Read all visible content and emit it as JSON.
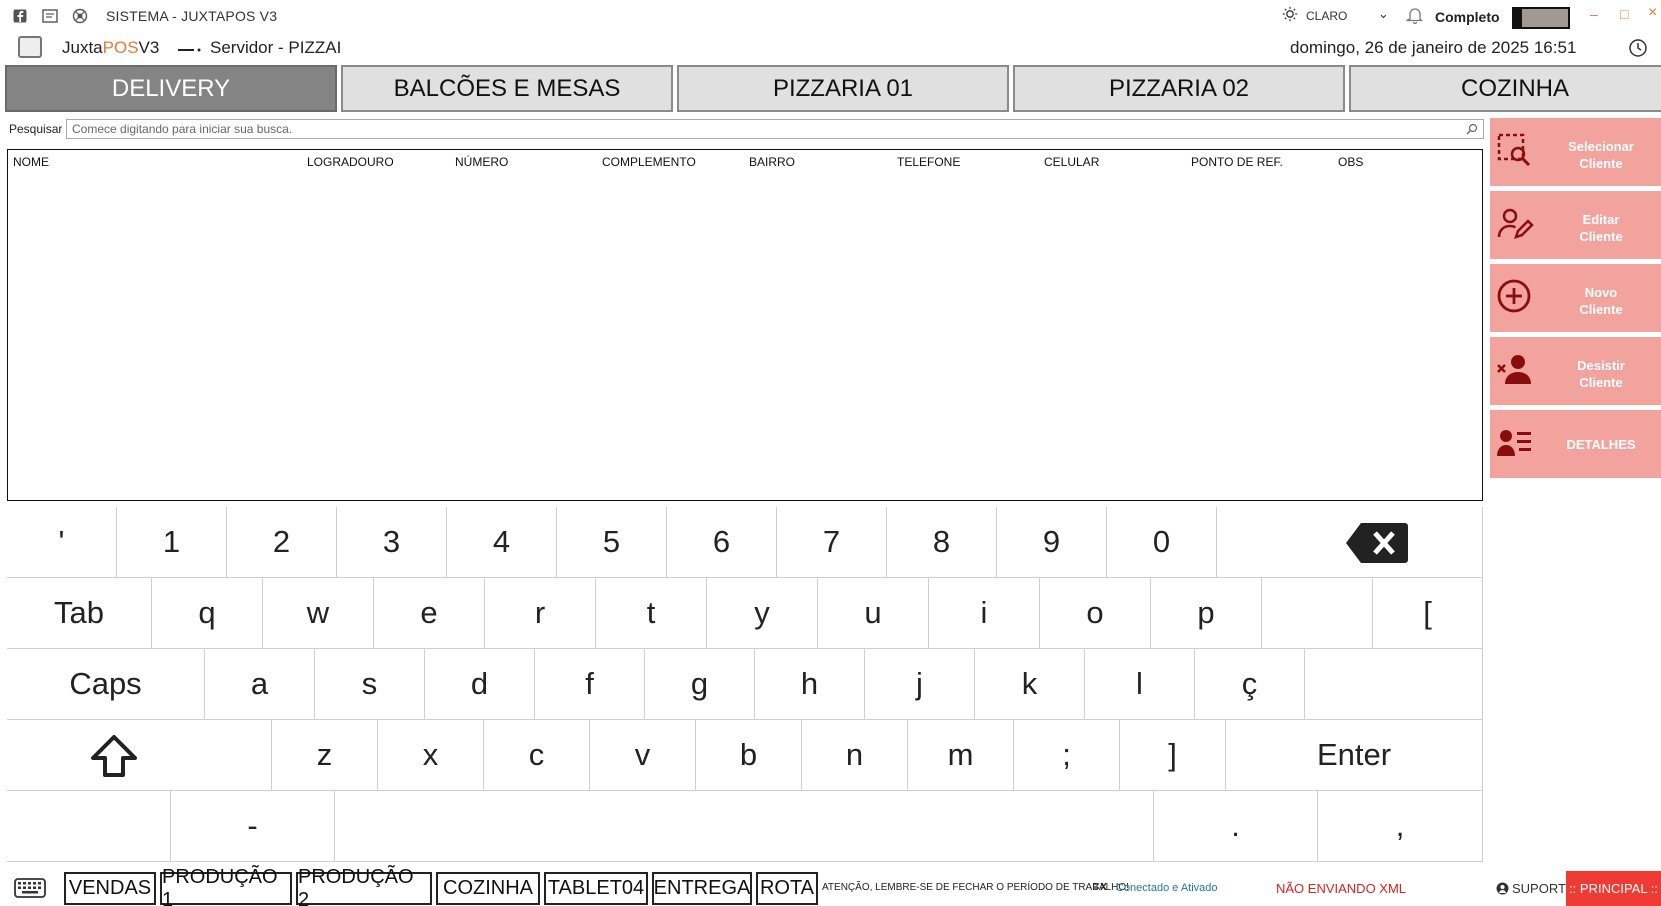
{
  "titlebar": {
    "title": "SISTEMA - JUXTAPOS V3",
    "theme_label": "CLARO",
    "theme_chevron": "⌄",
    "mode_label": "Completo",
    "minimize": "–",
    "maximize": "□",
    "close": "×"
  },
  "header": {
    "app_name_prefix": "Juxta",
    "app_name_highlight": "POS",
    "app_name_suffix": "V3",
    "server": "Servidor - PIZZAI",
    "datetime": "domingo, 26 de janeiro de 2025 16:51"
  },
  "tabs": [
    {
      "label": "DELIVERY",
      "active": true
    },
    {
      "label": "BALCÕES E MESAS",
      "active": false
    },
    {
      "label": "PIZZARIA 01",
      "active": false
    },
    {
      "label": "PIZZARIA 02",
      "active": false
    },
    {
      "label": "COZINHA",
      "active": false
    }
  ],
  "search": {
    "label": "Pesquisar",
    "placeholder": "Comece digitando para iniciar sua busca.",
    "value": ""
  },
  "grid": {
    "columns": [
      "NOME",
      "LOGRADOURO",
      "NÚMERO",
      "COMPLEMENTO",
      "BAIRRO",
      "TELEFONE",
      "CELULAR",
      "PONTO DE REF.",
      "OBS"
    ],
    "rows": []
  },
  "side_actions": [
    {
      "line1": "Selecionar",
      "line2": "Cliente",
      "icon": "select-search-icon"
    },
    {
      "line1": "Editar",
      "line2": "Cliente",
      "icon": "user-edit-icon"
    },
    {
      "line1": "Novo",
      "line2": "Cliente",
      "icon": "plus-circle-icon"
    },
    {
      "line1": "Desistir",
      "line2": "Cliente",
      "icon": "user-remove-icon"
    },
    {
      "line1": "DETALHES",
      "line2": "",
      "icon": "user-details-icon"
    }
  ],
  "keyboard": {
    "row1": [
      "'",
      "1",
      "2",
      "3",
      "4",
      "5",
      "6",
      "7",
      "8",
      "9",
      "0",
      ""
    ],
    "row2": [
      "Tab",
      "q",
      "w",
      "e",
      "r",
      "t",
      "y",
      "u",
      "i",
      "o",
      "p",
      "",
      "["
    ],
    "row3": [
      "Caps",
      "a",
      "s",
      "d",
      "f",
      "g",
      "h",
      "j",
      "k",
      "l",
      "ç",
      ""
    ],
    "row4": [
      "",
      "z",
      "x",
      "c",
      "v",
      "b",
      "n",
      "m",
      ";",
      "]",
      "Enter"
    ],
    "row5": [
      "",
      "-",
      "",
      ".",
      ","
    ]
  },
  "statusbar": {
    "buttons": [
      "VENDAS",
      "PRODUÇÃO 1",
      "PRODUÇÃO 2",
      "COZINHA",
      "TABLET04",
      "ENTREGA",
      "ROTA"
    ],
    "warning": "ATENÇÃO, LEMBRE-SE DE FECHAR O PERÍODO DE TRABALHO!",
    "connection": "Conectado e Ativado",
    "xml_status": "NÃO ENVIANDO XML",
    "support": "SUPORTE",
    "principal": ":: PRINCIPAL ::"
  },
  "colors": {
    "accent": "#e8793a",
    "side_button": "#f2a39e",
    "side_icon": "#8a0d0d",
    "tab_active": "#848484",
    "tab_inactive": "#e0e0e0",
    "danger": "#d8231c",
    "principal_bg": "#ef3b34",
    "connected": "#1f7a95"
  }
}
